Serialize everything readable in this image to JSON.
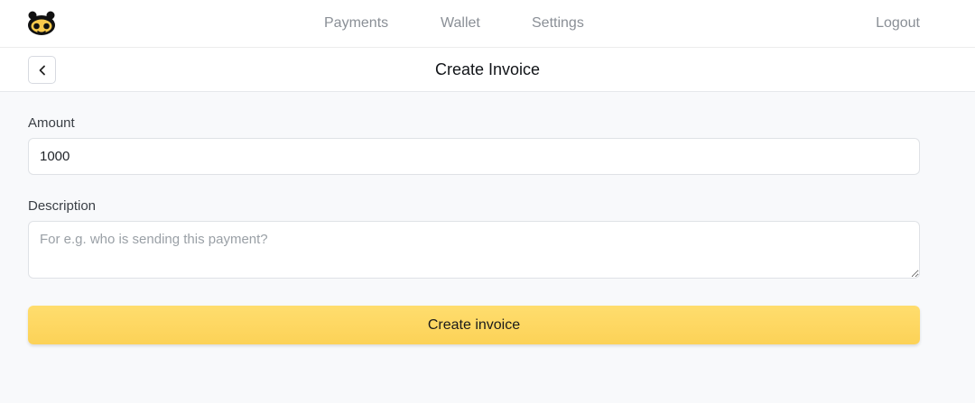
{
  "nav": {
    "links": [
      "Payments",
      "Wallet",
      "Settings"
    ],
    "logout_label": "Logout"
  },
  "header": {
    "title": "Create Invoice"
  },
  "form": {
    "amount_label": "Amount",
    "amount_value": "1000",
    "description_label": "Description",
    "description_placeholder": "For e.g. who is sending this payment?",
    "submit_label": "Create invoice"
  },
  "colors": {
    "accent": "#fcd257",
    "nav_text": "#8a8f96",
    "background": "#f8f9fb"
  },
  "icons": {
    "logo": "bee-face-icon",
    "back": "chevron-left-icon"
  }
}
